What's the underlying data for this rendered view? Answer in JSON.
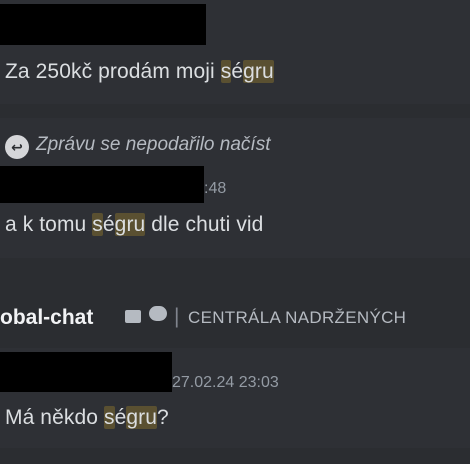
{
  "messages": [
    {
      "timestamp_partial": "",
      "text_before": "Za 250kč prodám moji ",
      "highlight_a": "s",
      "highlight_b": "é",
      "highlight_c": "gru",
      "text_after": ""
    },
    {
      "reply_text": "Zprávu se nepodařilo načíst",
      "timestamp_partial": ":48",
      "text_before": "a k tomu ",
      "highlight_a": "s",
      "highlight_b": "é",
      "highlight_c": "gru",
      "text_after": " dle chuti vid"
    },
    {
      "timestamp_partial": "27.02.24 23:03",
      "text_before": "Má někdo ",
      "highlight_a": "s",
      "highlight_b": "é",
      "highlight_c": "gru",
      "text_after": "?"
    }
  ],
  "channel": {
    "name_partial": "obal-chat",
    "separator": "|",
    "category": "CENTRÁLA NADRŽENÝCH"
  },
  "icons": [
    "reply-icon",
    "folder-icon",
    "chat-bubble-icon"
  ],
  "colors": {
    "background": "#313338",
    "highlight": "#5a5031",
    "redaction": "#000000"
  }
}
